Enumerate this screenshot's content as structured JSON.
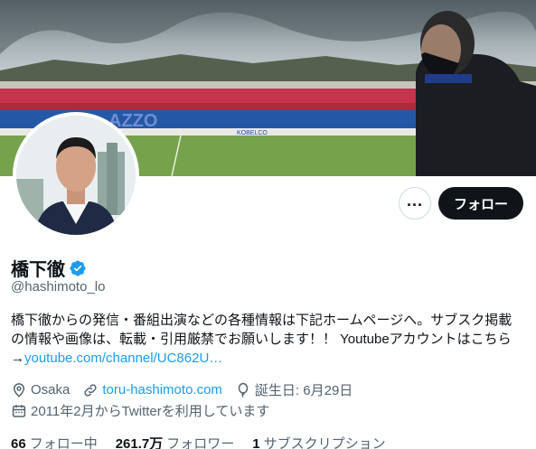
{
  "profile": {
    "display_name": "橋下徹",
    "handle": "@hashimoto_lo",
    "follow_label": "フォロー",
    "more_label": "...",
    "bio_line1": "橋下徹からの発信・番組出演などの各種情報は下記ホームページへ。サブスク掲載",
    "bio_line2": "の情報や画像は、転載・引用厳禁でお願いします！！ Youtubeアカウントはこちら",
    "bio_arrow": "→",
    "bio_link": "youtube.com/channel/UC862U…",
    "location": "Osaka",
    "website": "toru-hashimoto.com",
    "birthday": "誕生日: 6月29日",
    "joined": "2011年2月からTwitterを利用しています",
    "following_count": "66",
    "following_label": "フォロー中",
    "followers_count": "261.7万",
    "followers_label": "フォロワー",
    "subscriptions_count": "1",
    "subscriptions_label": "サブスクリプション"
  },
  "banner": {
    "stadium_text": "AZZO",
    "sponsor_text": "KOBELCO"
  },
  "colors": {
    "accent": "#1d9bf0",
    "text_primary": "#0f1419",
    "text_secondary": "#536471"
  },
  "icons": {
    "verified": "verified-badge-icon",
    "location": "location-pin-icon",
    "link": "link-icon",
    "birthday": "balloon-icon",
    "calendar": "calendar-icon"
  }
}
